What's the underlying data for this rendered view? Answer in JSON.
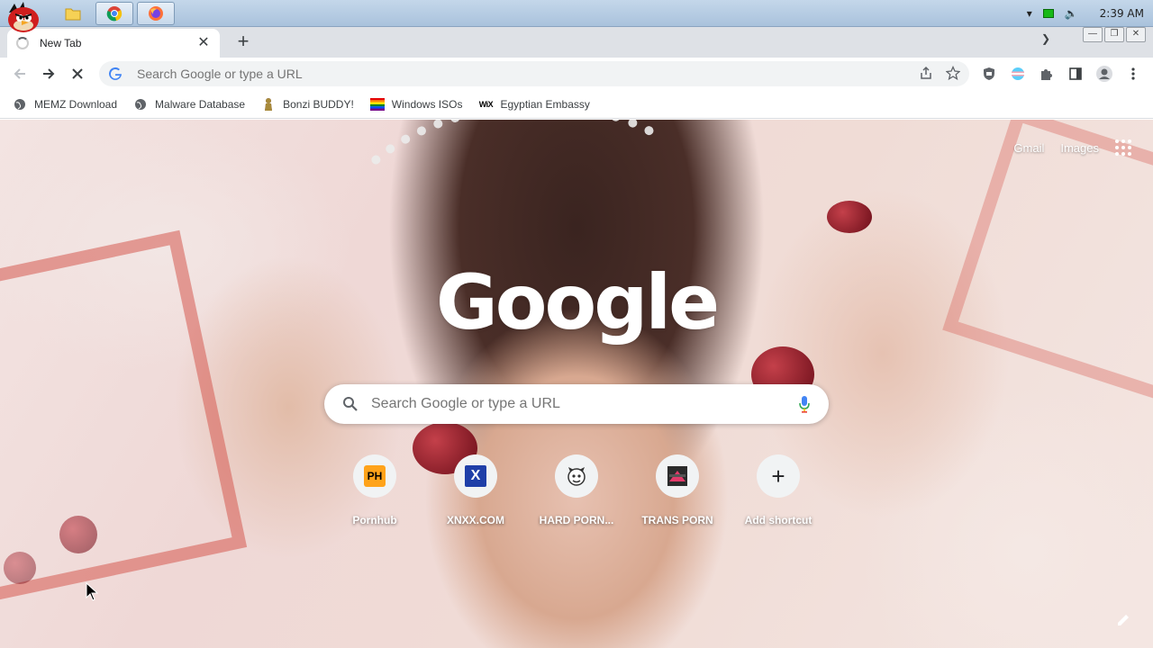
{
  "taskbar": {
    "clock": "2:39 AM",
    "apps": [
      "file-explorer",
      "chrome",
      "firefox"
    ]
  },
  "tab": {
    "title": "New Tab"
  },
  "omnibox": {
    "placeholder": "Search Google or type a URL"
  },
  "bookmarks": [
    {
      "label": "MEMZ Download",
      "icon": "globe-icon"
    },
    {
      "label": "Malware Database",
      "icon": "globe-icon"
    },
    {
      "label": "Bonzi BUDDY!",
      "icon": "bonzi-icon"
    },
    {
      "label": "Windows ISOs",
      "icon": "windows-flag-icon"
    },
    {
      "label": "Egyptian Embassy",
      "icon": "wix-icon"
    }
  ],
  "ntp": {
    "gmail": "Gmail",
    "images": "Images",
    "logo": "Google",
    "search_placeholder": "Search Google or type a URL",
    "shortcuts": [
      {
        "label": "Pornhub",
        "icon_text": "PH"
      },
      {
        "label": "XNXX.COM",
        "icon_text": "X"
      },
      {
        "label": "HARD PORN...",
        "icon_text": ""
      },
      {
        "label": "TRANS PORN",
        "icon_text": ""
      },
      {
        "label": "Add shortcut",
        "icon_text": "+"
      }
    ]
  },
  "colors": {
    "accent": "#1a73e8",
    "taskbar": "#b7cde3",
    "tabstrip": "#dee1e6"
  }
}
